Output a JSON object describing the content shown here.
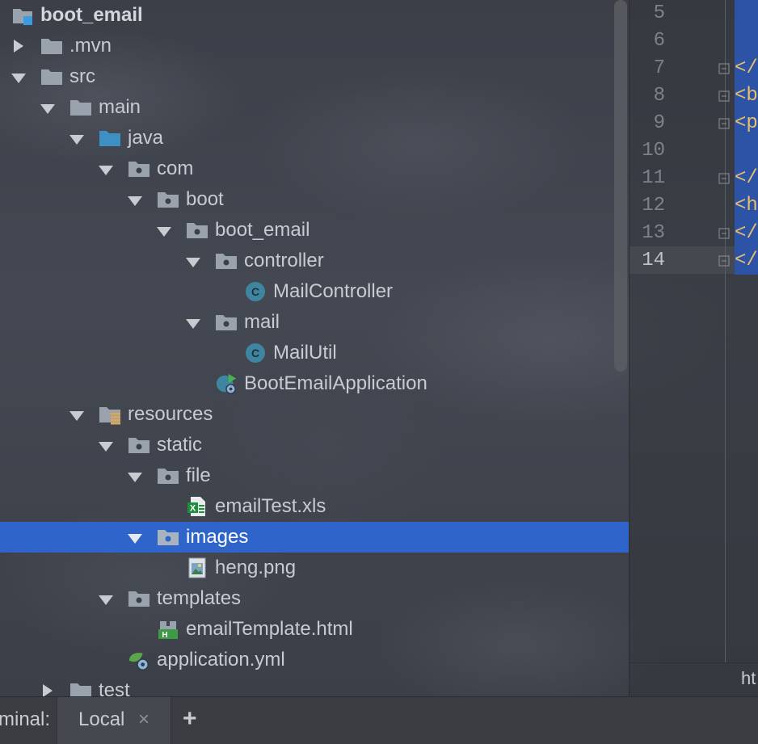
{
  "project_tree": {
    "root": {
      "label": "boot_email"
    },
    "nodes": [
      {
        "label": ".mvn"
      },
      {
        "label": "src"
      },
      {
        "label": "main"
      },
      {
        "label": "java"
      },
      {
        "label": "com"
      },
      {
        "label": "boot"
      },
      {
        "label": "boot_email"
      },
      {
        "label": "controller"
      },
      {
        "label": "MailController"
      },
      {
        "label": "mail"
      },
      {
        "label": "MailUtil"
      },
      {
        "label": "BootEmailApplication"
      },
      {
        "label": "resources"
      },
      {
        "label": "static"
      },
      {
        "label": "file"
      },
      {
        "label": "emailTest.xls"
      },
      {
        "label": "images"
      },
      {
        "label": "heng.png"
      },
      {
        "label": "templates"
      },
      {
        "label": "emailTemplate.html"
      },
      {
        "label": "application.yml"
      },
      {
        "label": "test"
      }
    ],
    "selected": "images"
  },
  "editor": {
    "line_numbers": [
      "5",
      "6",
      "7",
      "8",
      "9",
      "10",
      "11",
      "12",
      "13",
      "14"
    ],
    "current_line": "14",
    "code_fragments": [
      "</",
      "<b",
      "<p",
      "</",
      "<h",
      "</",
      "</"
    ],
    "status_text": "ht"
  },
  "terminal_bar": {
    "label": "minal:",
    "tab_label": "Local",
    "tab_close": "×",
    "add_label": "+"
  },
  "colors": {
    "selection": "#2f65ca",
    "folder": "#9aa3ad",
    "source_folder": "#3d8fc4",
    "class_icon": "#3e86a0",
    "code_tag": "#e8bf6a"
  }
}
